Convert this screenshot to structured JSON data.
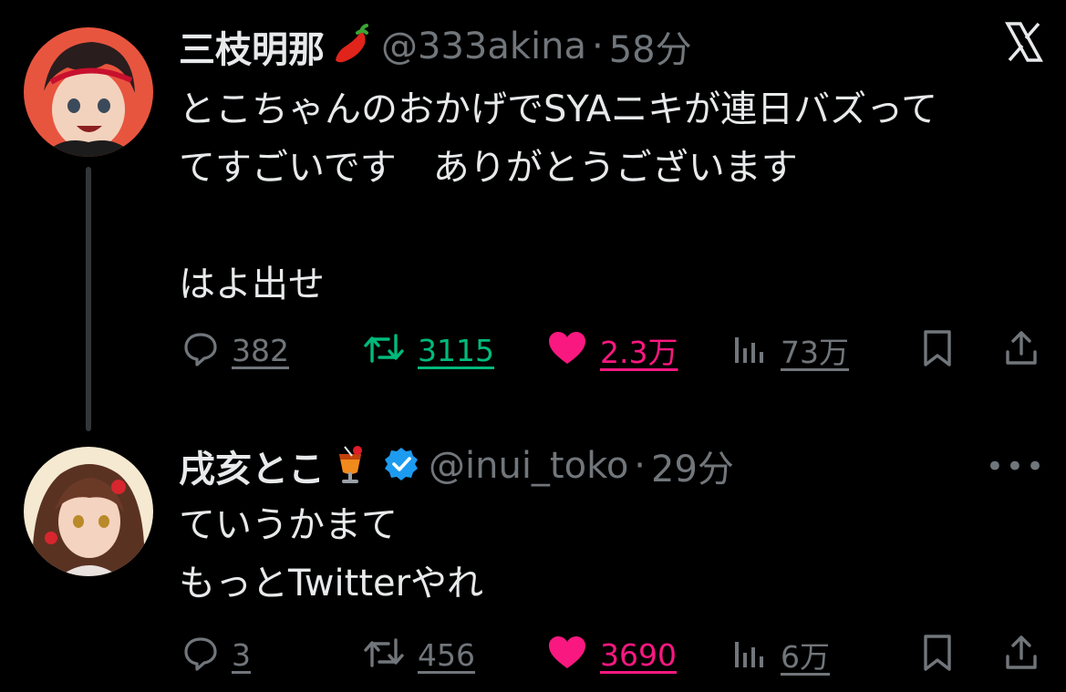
{
  "tweets": [
    {
      "name": "三枝明那",
      "name_emoji": "hot-pepper",
      "handle": "@333akina",
      "separator": "·",
      "time": "58分",
      "body": "とこちゃんのおかげでSYAニキが連日バズって\nてすごいです　ありがとうございます\n\nはよ出せ",
      "reply_count": "382",
      "retweet_count": "3115",
      "like_count": "2.3万",
      "view_count": "73万",
      "retweet_active": true,
      "like_active": true,
      "corner_icon": "x-logo-icon"
    },
    {
      "name": "戌亥とこ",
      "name_emoji": "tropical-drink",
      "verified": true,
      "handle": "@inui_toko",
      "separator": "·",
      "time": "29分",
      "body": "ていうかまて\nもっとTwitterやれ",
      "reply_count": "3",
      "retweet_count": "456",
      "like_count": "3690",
      "view_count": "6万",
      "retweet_active": false,
      "like_active": true,
      "corner_icon": "more-icon"
    }
  ],
  "colors": {
    "background": "#000000",
    "text": "#e7e9ea",
    "muted": "#71767b",
    "retweet_green": "#00ba7c",
    "like_pink": "#f91880",
    "verified_blue": "#1d9bf0"
  }
}
